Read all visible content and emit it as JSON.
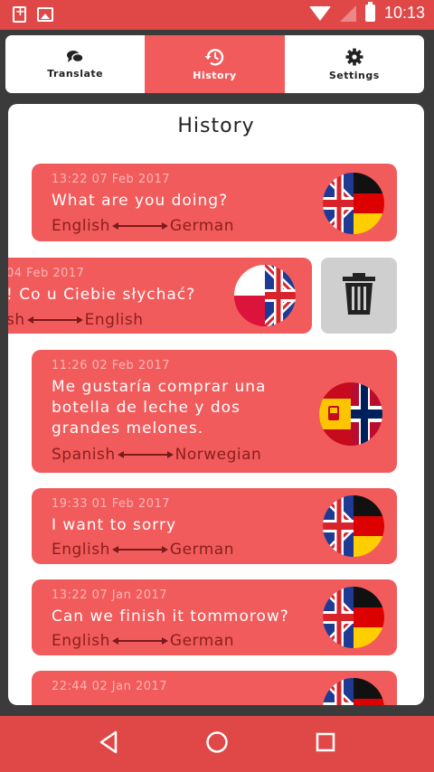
{
  "status_bar": {
    "time": "10:13",
    "left_icons": [
      "battery-plus-icon",
      "image-icon"
    ],
    "right_icons": [
      "wifi-icon",
      "signal-icon",
      "battery-icon"
    ]
  },
  "tabs": [
    {
      "label": "Translate",
      "icon": "chat-bubbles-icon",
      "active": false
    },
    {
      "label": "History",
      "icon": "history-icon",
      "active": true
    },
    {
      "label": "Settings",
      "icon": "gear-icon",
      "active": false
    }
  ],
  "panel": {
    "title": "History"
  },
  "history": [
    {
      "time": "13:22 07 Feb 2017",
      "text": "What are you doing?",
      "from": "English",
      "to": "German",
      "flag": "uk-de"
    },
    {
      "time": "04 Feb 2017",
      "text": "¿! Co u Ciebie słychać?",
      "from": "sh",
      "to": "English",
      "flag": "pl-uk"
    },
    {
      "time": "11:26 02 Feb 2017",
      "text": "Me gustaría comprar una botella de leche y dos grandes melones.",
      "from": "Spanish",
      "to": "Norwegian",
      "flag": "es-no"
    },
    {
      "time": "19:33 01 Feb 2017",
      "text": "I want to sorry",
      "from": "English",
      "to": "German",
      "flag": "uk-de"
    },
    {
      "time": "13:22 07 Jan 2017",
      "text": "Can we finish it tommorow?",
      "from": "English",
      "to": "German",
      "flag": "uk-de"
    },
    {
      "time": "22:44 02 Jan 2017",
      "text": "",
      "from": "",
      "to": "",
      "flag": "uk-de"
    }
  ],
  "delete_action": {
    "icon": "trash-icon"
  },
  "nav_bar": {
    "buttons": [
      "back-icon",
      "home-icon",
      "recents-icon"
    ]
  },
  "colors": {
    "accent": "#f25b5b",
    "status_bar": "#e04848",
    "background": "#3b3b3b"
  }
}
